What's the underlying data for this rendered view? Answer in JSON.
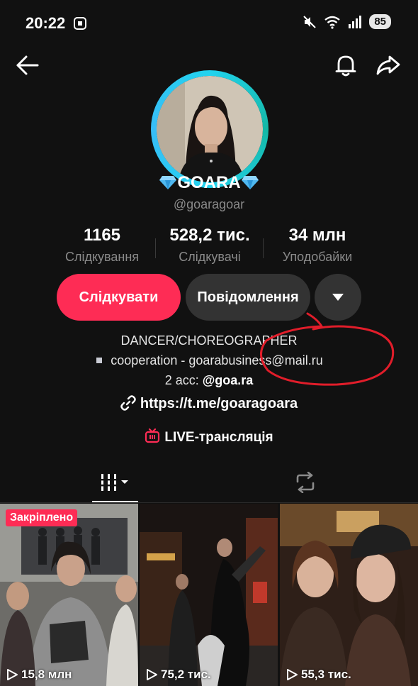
{
  "status_bar": {
    "time": "20:22",
    "battery": "85",
    "icons": [
      "screen-record-icon",
      "mute-icon",
      "wifi-icon",
      "signal-icon"
    ]
  },
  "nav": {
    "icons": [
      "back-arrow-icon",
      "bell-icon",
      "share-icon"
    ]
  },
  "profile": {
    "display_name": "GOARA",
    "name_decoration": "gem-icon",
    "username": "@goaragoar",
    "ring_color": "#22d3ee"
  },
  "stats": [
    {
      "value": "1165",
      "label": "Слідкування"
    },
    {
      "value": "528,2 тис.",
      "label": "Слідкувачі"
    },
    {
      "value": "34 млн",
      "label": "Уподобайки"
    }
  ],
  "actions": {
    "follow_label": "Слідкувати",
    "message_label": "Повідомлення",
    "more_icon": "chevron-down-icon",
    "follow_color": "#fe2c55"
  },
  "bio": {
    "line1": "DANCER/CHOREOGRAPHER",
    "line2": "cooperation - goarabusiness@mail.ru",
    "line3_prefix": "2 acc: ",
    "line3_handle": "@goa.ra",
    "link": "https://t.me/goaragoara"
  },
  "live": {
    "label": "LIVE-трансляція",
    "icon": "live-tv-icon"
  },
  "tabs": [
    {
      "icon": "videos-grid-icon"
    },
    {
      "icon": "repost-icon"
    }
  ],
  "videos": [
    {
      "pinned_label": "Закріплено",
      "views": "15,8 млн"
    },
    {
      "views": "75,2 тис."
    },
    {
      "views": "55,3 тис."
    }
  ],
  "annotation_color": "#e11d2a"
}
